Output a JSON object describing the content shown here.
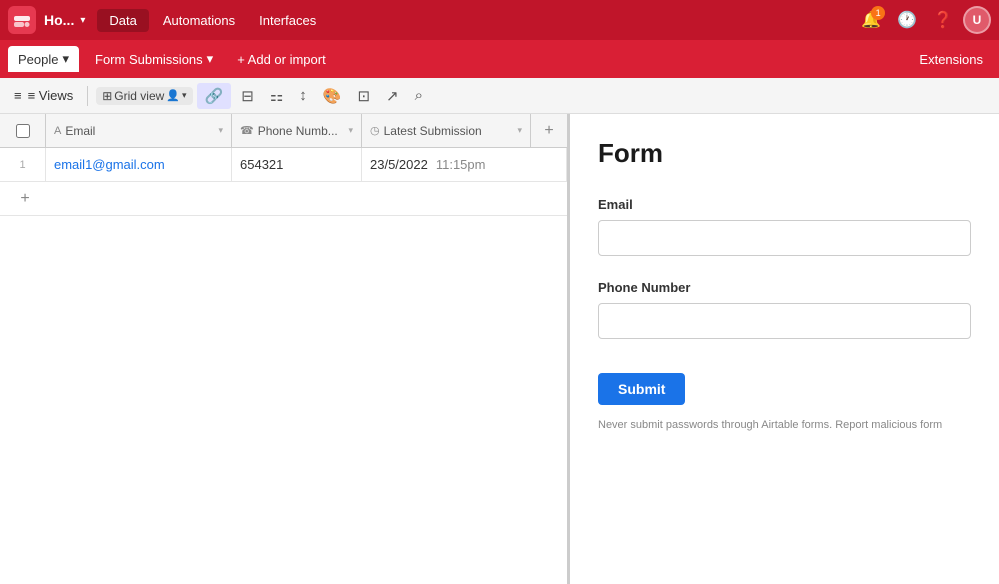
{
  "topNav": {
    "logo_text": "Ho...",
    "chevron": "▾",
    "data_label": "Data",
    "automations_label": "Automations",
    "interfaces_label": "Interfaces",
    "notification_count": "1",
    "avatar_initials": "U"
  },
  "secondToolbar": {
    "people_label": "People",
    "chevron": "▾",
    "form_submissions_label": "Form Submissions",
    "dropdown_chevron": "▾",
    "add_label": "+ Add or import",
    "extensions_label": "Extensions"
  },
  "viewsBar": {
    "views_label": "≡ Views",
    "grid_view_label": "Grid view",
    "icons": {
      "filter": "⊟",
      "group": "⚏",
      "sort": "↕",
      "paint": "◈",
      "hide": "⊡",
      "share": "↗",
      "search": "⌕"
    }
  },
  "table": {
    "columns": [
      {
        "id": "email",
        "icon": "A",
        "label": "Email",
        "type": "text"
      },
      {
        "id": "phone",
        "icon": "☎",
        "label": "Phone Numb...",
        "type": "phone"
      },
      {
        "id": "latest",
        "icon": "◷",
        "label": "Latest Submission",
        "type": "date"
      }
    ],
    "rows": [
      {
        "num": "1",
        "email": "email1@gmail.com",
        "phone": "654321",
        "date": "23/5/2022",
        "time": "11:15pm"
      }
    ]
  },
  "form": {
    "title": "Form",
    "email_label": "Email",
    "email_placeholder": "",
    "phone_label": "Phone Number",
    "phone_placeholder": "",
    "submit_label": "Submit",
    "disclaimer": "Never submit passwords through Airtable forms. Report malicious form"
  }
}
